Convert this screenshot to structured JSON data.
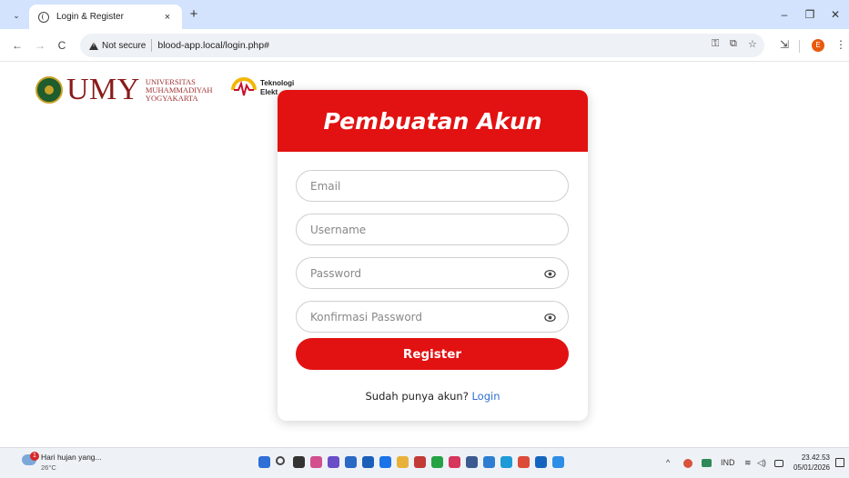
{
  "browser": {
    "tab_title": "Login & Register",
    "tab_close": "×",
    "new_tab": "+",
    "tab_menu": "⌄",
    "minimize": "–",
    "restore": "❐",
    "close": "✕",
    "back": "←",
    "forward": "→",
    "reload": "C",
    "security_label": "Not secure",
    "url": "blood-app.local/login.php#",
    "password_key_icon": "⚿",
    "translate_icon": "⧉",
    "bookmark_icon": "☆",
    "extensions_icon": "⇲",
    "profile_initial": "E",
    "menu_icon": "⋮"
  },
  "page": {
    "logo_umy": {
      "word": "UMY",
      "sub_lines": [
        "UNIVERSITAS",
        "MUHAMMADIYAH",
        "YOGYAKARTA"
      ]
    },
    "logo_te": {
      "lines": [
        "Teknologi",
        "Elekt"
      ]
    },
    "form": {
      "title": "Pembuatan Akun",
      "email_placeholder": "Email",
      "username_placeholder": "Username",
      "password_placeholder": "Password",
      "confirm_password_placeholder": "Konfirmasi Password",
      "register_label": "Register",
      "login_prompt": "Sudah punya akun?",
      "login_link": "Login"
    }
  },
  "taskbar": {
    "weather_text": "Hari hujan yang...",
    "weather_temp": "26°C",
    "weather_badge": "1",
    "tray_chevron": "^",
    "language": "IND",
    "wifi_icon": "≋",
    "volume_icon": "◁)",
    "time": "23.42.53",
    "date": "05/01/2026",
    "apps": [
      {
        "name": "start-icon",
        "color": "#2f6fd6"
      },
      {
        "name": "search-icon",
        "color": "#444444"
      },
      {
        "name": "task-view-icon",
        "color": "#333333"
      },
      {
        "name": "widgets-icon",
        "color": "#d24e8f"
      },
      {
        "name": "app-icon",
        "color": "#6a4ec7"
      },
      {
        "name": "app-icon",
        "color": "#2c68c5"
      },
      {
        "name": "app-icon",
        "color": "#1c5fb8"
      },
      {
        "name": "app-icon",
        "color": "#1a73e8"
      },
      {
        "name": "file-explorer-icon",
        "color": "#e8b23a"
      },
      {
        "name": "app-icon",
        "color": "#c23b36"
      },
      {
        "name": "whatsapp-icon",
        "color": "#25a244"
      },
      {
        "name": "app-icon",
        "color": "#d6365b"
      },
      {
        "name": "app-icon",
        "color": "#3c5a8f"
      },
      {
        "name": "vscode-icon",
        "color": "#2d7dd2"
      },
      {
        "name": "edge-icon",
        "color": "#1e9bd7"
      },
      {
        "name": "chrome-icon",
        "color": "#dd4b39"
      },
      {
        "name": "outlook-icon",
        "color": "#1565c0"
      },
      {
        "name": "app-icon",
        "color": "#2e8de6"
      }
    ]
  },
  "colors": {
    "brand_red": "#e21212",
    "link_blue": "#2f6fd6"
  }
}
